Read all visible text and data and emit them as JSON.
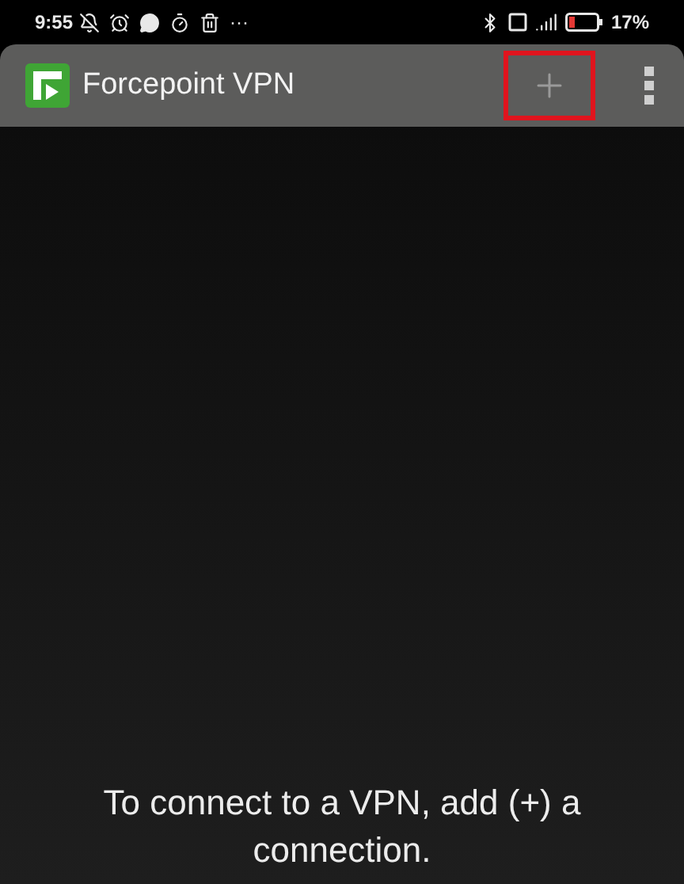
{
  "status_bar": {
    "time": "9:55",
    "more": "···",
    "battery": "17%"
  },
  "app_bar": {
    "title": "Forcepoint VPN",
    "add_highlighted": true
  },
  "empty_message": "To connect to a VPN, add (+) a connection."
}
